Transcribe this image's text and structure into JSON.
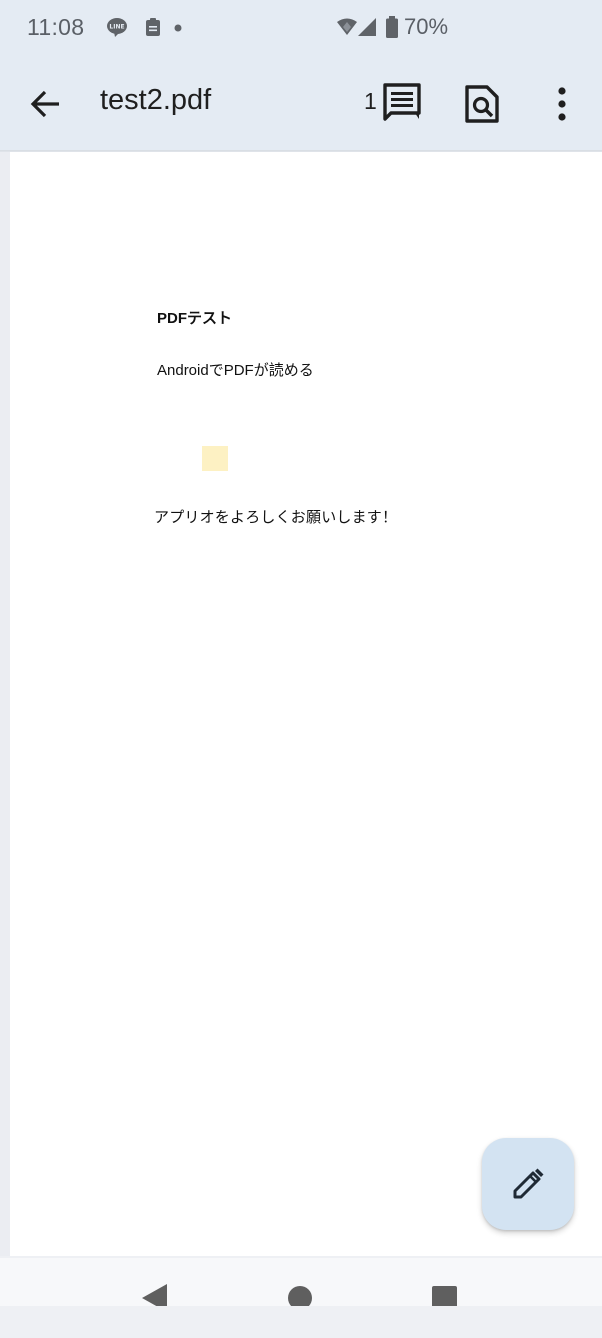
{
  "status_bar": {
    "time": "11:08",
    "battery": "70%",
    "icons": [
      "line-app-icon",
      "clipboard-icon",
      "dot-icon",
      "wifi-icon",
      "signal-icon",
      "battery-icon"
    ]
  },
  "app_bar": {
    "title": "test2.pdf",
    "comment_count": "1",
    "icons": [
      "back-arrow-icon",
      "comment-icon",
      "find-in-page-icon",
      "more-vert-icon"
    ]
  },
  "document": {
    "heading": "PDFテスト",
    "line1": "AndroidでPDFが読める",
    "body": "アプリオをよろしくお願いします！",
    "annotation_color": "#fdf1c3"
  },
  "fab": {
    "icon": "edit-pencil-icon",
    "color": "#d3e3f2"
  },
  "nav_bar": {
    "icons": [
      "nav-back-icon",
      "nav-home-icon",
      "nav-recents-icon"
    ]
  }
}
